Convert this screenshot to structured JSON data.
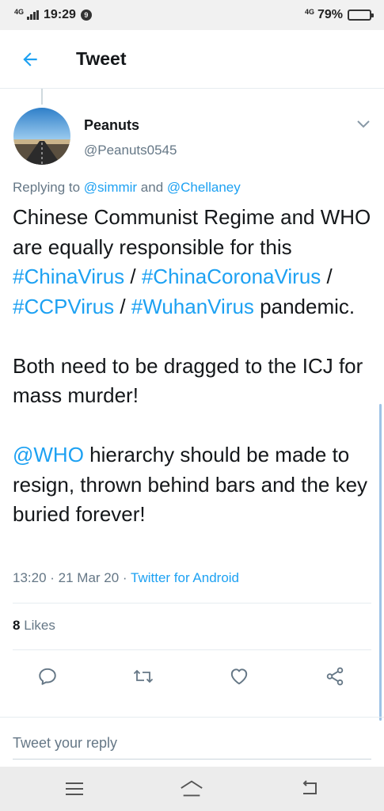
{
  "status_bar": {
    "network_left": "4G",
    "time": "19:29",
    "notification_badge": "9",
    "network_right": "4G",
    "battery": "79%",
    "battery_level": 0.79
  },
  "app_bar": {
    "back_icon": "arrow-left-icon",
    "title": "Tweet"
  },
  "tweet": {
    "display_name": "Peanuts",
    "handle": "@Peanuts0545",
    "replying_prefix": "Replying to ",
    "replying_user1": "@simmir",
    "replying_and": " and ",
    "replying_user2": "@Chellaney",
    "text": {
      "p1": "Chinese Communist Regime and WHO are equally responsible for this ",
      "tag1": "#ChinaVirus",
      "sep1": " / ",
      "tag2": "#ChinaCoronaVirus",
      "sep2": " / ",
      "tag3": "#CCPVirus",
      "sep3": " / ",
      "tag4": "#WuhanVirus",
      "p2": " pandemic.\n\nBoth need to be dragged to the ICJ for mass murder!\n\n",
      "mention": "@WHO",
      "p3": " hierarchy should be made to resign, thrown behind bars and the key buried forever!"
    },
    "timestamp": "13:20 · 21 Mar 20 · ",
    "source": "Twitter for Android",
    "likes_count": "8",
    "likes_label": " Likes"
  },
  "actions": [
    "reply-icon",
    "retweet-icon",
    "like-icon",
    "share-icon"
  ],
  "reply_box": {
    "placeholder": "Tweet your reply"
  },
  "nav_bar": [
    "menu-icon",
    "home-icon",
    "back-icon"
  ],
  "colors": {
    "accent": "#1da1f2",
    "secondary_text": "#657786",
    "primary_text": "#14171a"
  }
}
